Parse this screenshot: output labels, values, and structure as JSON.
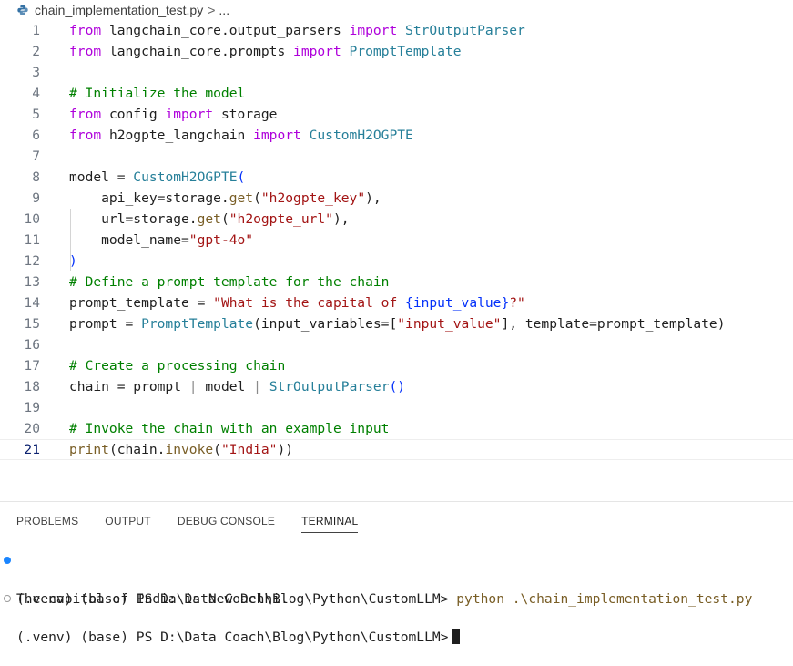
{
  "breadcrumb": {
    "file": "chain_implementation_test.py",
    "separator": ">",
    "more": "..."
  },
  "editor": {
    "active_line": 21,
    "lines": [
      {
        "n": "1",
        "segs": [
          {
            "t": "from",
            "c": "kw"
          },
          {
            "t": " langchain_core.output_parsers "
          },
          {
            "t": "import",
            "c": "kw"
          },
          {
            "t": " "
          },
          {
            "t": "StrOutputParser",
            "c": "cls"
          }
        ]
      },
      {
        "n": "2",
        "segs": [
          {
            "t": "from",
            "c": "kw"
          },
          {
            "t": " langchain_core.prompts "
          },
          {
            "t": "import",
            "c": "kw"
          },
          {
            "t": " "
          },
          {
            "t": "PromptTemplate",
            "c": "cls"
          }
        ]
      },
      {
        "n": "3",
        "segs": []
      },
      {
        "n": "4",
        "segs": [
          {
            "t": "# Initialize the model",
            "c": "cmt"
          }
        ]
      },
      {
        "n": "5",
        "segs": [
          {
            "t": "from",
            "c": "kw"
          },
          {
            "t": " config "
          },
          {
            "t": "import",
            "c": "kw"
          },
          {
            "t": " storage"
          }
        ]
      },
      {
        "n": "6",
        "segs": [
          {
            "t": "from",
            "c": "kw"
          },
          {
            "t": " h2ogpte_langchain "
          },
          {
            "t": "import",
            "c": "kw"
          },
          {
            "t": " "
          },
          {
            "t": "CustomH2OGPTE",
            "c": "cls"
          }
        ]
      },
      {
        "n": "7",
        "segs": []
      },
      {
        "n": "8",
        "segs": [
          {
            "t": "model = "
          },
          {
            "t": "CustomH2OGPTE",
            "c": "cls"
          },
          {
            "t": "(",
            "c": "br"
          }
        ]
      },
      {
        "n": "9",
        "segs": [
          {
            "t": "    api_key=storage."
          },
          {
            "t": "get",
            "c": "fn"
          },
          {
            "t": "("
          },
          {
            "t": "\"h2ogpte_key\"",
            "c": "str"
          },
          {
            "t": "),"
          }
        ]
      },
      {
        "n": "10",
        "segs": [
          {
            "t": "    url=storage."
          },
          {
            "t": "get",
            "c": "fn"
          },
          {
            "t": "("
          },
          {
            "t": "\"h2ogpte_url\"",
            "c": "str"
          },
          {
            "t": "),"
          }
        ]
      },
      {
        "n": "11",
        "segs": [
          {
            "t": "    model_name="
          },
          {
            "t": "\"gpt-4o\"",
            "c": "str"
          }
        ]
      },
      {
        "n": "12",
        "segs": [
          {
            "t": ")",
            "c": "br"
          }
        ]
      },
      {
        "n": "13",
        "segs": [
          {
            "t": "# Define a prompt template for the chain",
            "c": "cmt"
          }
        ]
      },
      {
        "n": "14",
        "segs": [
          {
            "t": "prompt_template = "
          },
          {
            "t": "\"What is the capital of ",
            "c": "str"
          },
          {
            "t": "{input_value}",
            "c": "br"
          },
          {
            "t": "?\"",
            "c": "str"
          }
        ]
      },
      {
        "n": "15",
        "segs": [
          {
            "t": "prompt = "
          },
          {
            "t": "PromptTemplate",
            "c": "cls"
          },
          {
            "t": "(input_variables=["
          },
          {
            "t": "\"input_value\"",
            "c": "str"
          },
          {
            "t": "], template=prompt_template)"
          }
        ]
      },
      {
        "n": "16",
        "segs": []
      },
      {
        "n": "17",
        "segs": [
          {
            "t": "# Create a processing chain",
            "c": "cmt"
          }
        ]
      },
      {
        "n": "18",
        "segs": [
          {
            "t": "chain = prompt "
          },
          {
            "t": "|",
            "c": "pipe"
          },
          {
            "t": " model "
          },
          {
            "t": "|",
            "c": "pipe"
          },
          {
            "t": " "
          },
          {
            "t": "StrOutputParser",
            "c": "cls"
          },
          {
            "t": "()",
            "c": "br"
          }
        ]
      },
      {
        "n": "19",
        "segs": []
      },
      {
        "n": "20",
        "segs": [
          {
            "t": "# Invoke the chain with an example input",
            "c": "cmt"
          }
        ]
      },
      {
        "n": "21",
        "segs": [
          {
            "t": "print",
            "c": "fn"
          },
          {
            "t": "(chain."
          },
          {
            "t": "invoke",
            "c": "fn"
          },
          {
            "t": "("
          },
          {
            "t": "\"India\"",
            "c": "str"
          },
          {
            "t": "))"
          }
        ]
      }
    ]
  },
  "panel": {
    "tabs": [
      "PROBLEMS",
      "OUTPUT",
      "DEBUG CONSOLE",
      "TERMINAL"
    ],
    "active_tab": "TERMINAL",
    "terminal": {
      "line1_prompt": "(.venv) (base) PS D:\\Data Coach\\Blog\\Python\\CustomLLM>",
      "line1_command": "python .\\chain_implementation_test.py",
      "line2_output": "The capital of India is New Delhi.",
      "line3_prompt": "(.venv) (base) PS D:\\Data Coach\\Blog\\Python\\CustomLLM>"
    }
  },
  "colors": {
    "keyword": "#af00db",
    "class": "#267f99",
    "string": "#a31515",
    "comment": "#008000",
    "function": "#795e26",
    "bracket": "#0431fa",
    "accent": "#1a85ff"
  }
}
